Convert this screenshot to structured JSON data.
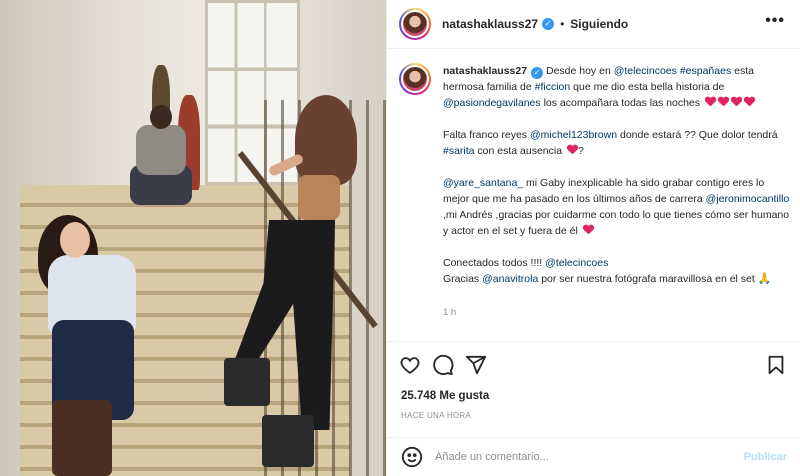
{
  "post": {
    "username": "natashaklauss27",
    "follow_status": "Siguiendo",
    "more_icon": "more-options-icon",
    "caption": {
      "p1_a": "Desde hoy en ",
      "p1_mention1": "@telecincoes",
      "p1_b": " ",
      "p1_hashtag1": "#españaes",
      "p1_c": " esta hermosa familia de ",
      "p1_hashtag2": "#ficcion",
      "p1_d": " que me dio esta bella historia de ",
      "p1_mention2": "@pasiondegavilanes",
      "p1_e": " los acompañara todas las noches",
      "p2_a": "Falta franco reyes ",
      "p2_mention": "@michel123brown",
      "p2_b": " donde estará ?? Que dolor tendrá ",
      "p2_hashtag": "#sarita",
      "p2_c": " con esta ausencia",
      "p2_d": "?",
      "p3_mention1": "@yare_santana_",
      "p3_a": " mi Gaby inexplicable ha sido grabar contigo eres lo mejor que me ha pasado en los últimos años de carrera ",
      "p3_mention2": "@jeronimocantillo",
      "p3_b": " ,mi Andrés ,gracias por cuidarme con todo lo que tienes cómo ser humano y actor en el set y fuera de él",
      "p4_a": "Conectados todos !!!! ",
      "p4_mention": "@telecincoes",
      "p5_a": "Gracias ",
      "p5_mention": "@anavitrola",
      "p5_b": " por ser nuestra fotógrafa maravillosa en el set",
      "time": "1 h"
    },
    "likes": "25.748 Me gusta",
    "posted_ago": "HACE UNA HORA",
    "comment_placeholder": "Añade un comentario...",
    "publish_label": "Publicar",
    "icons": [
      "heart-icon",
      "comment-icon",
      "share-icon",
      "bookmark-icon",
      "emoji-icon"
    ],
    "colors": {
      "link": "#00376b",
      "verified": "#3897f0",
      "heart": "#e0245e",
      "publish": "#b2dffc"
    }
  }
}
